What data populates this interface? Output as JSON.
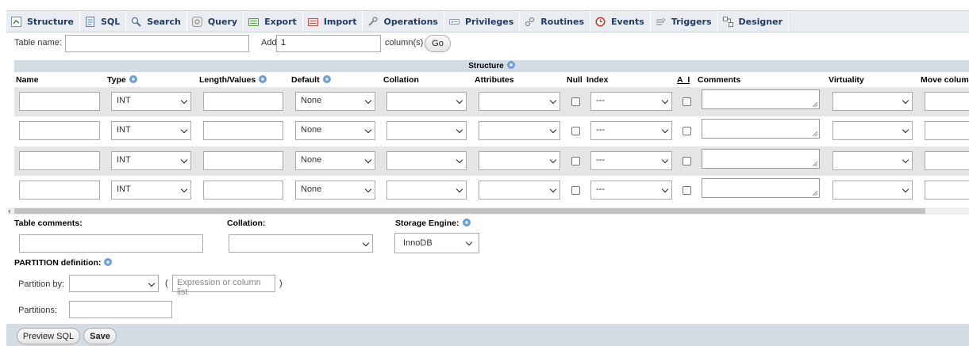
{
  "tabs": [
    {
      "label": "Structure",
      "icon": "structure-icon"
    },
    {
      "label": "SQL",
      "icon": "sql-icon"
    },
    {
      "label": "Search",
      "icon": "search-icon"
    },
    {
      "label": "Query",
      "icon": "query-icon"
    },
    {
      "label": "Export",
      "icon": "export-icon"
    },
    {
      "label": "Import",
      "icon": "import-icon"
    },
    {
      "label": "Operations",
      "icon": "wrench-icon"
    },
    {
      "label": "Privileges",
      "icon": "privileges-icon"
    },
    {
      "label": "Routines",
      "icon": "routines-icon"
    },
    {
      "label": "Events",
      "icon": "clock-icon"
    },
    {
      "label": "Triggers",
      "icon": "triggers-icon"
    },
    {
      "label": "Designer",
      "icon": "designer-icon"
    }
  ],
  "table_name": {
    "label": "Table name:",
    "value": ""
  },
  "add_columns": {
    "label": "Add",
    "value": "1",
    "suffix": "column(s)",
    "go": "Go"
  },
  "structure": {
    "title": "Structure",
    "columns": {
      "name": "Name",
      "type": "Type",
      "length": "Length/Values",
      "default": "Default",
      "collation": "Collation",
      "attributes": "Attributes",
      "null": "Null",
      "index": "Index",
      "ai": "A_I",
      "comments": "Comments",
      "virtuality": "Virtuality",
      "move": "Move column"
    },
    "rows": [
      {
        "type": "INT",
        "default": "None",
        "index": "---"
      },
      {
        "type": "INT",
        "default": "None",
        "index": "---"
      },
      {
        "type": "INT",
        "default": "None",
        "index": "---"
      },
      {
        "type": "INT",
        "default": "None",
        "index": "---"
      }
    ]
  },
  "table_options": {
    "comments_label": "Table comments:",
    "collation_label": "Collation:",
    "engine_label": "Storage Engine:",
    "engine_value": "InnoDB"
  },
  "partition": {
    "title": "PARTITION definition:",
    "by_label": "Partition by:",
    "open_paren": "(",
    "expression_placeholder": "Expression or column list",
    "close_paren": ")",
    "partitions_label": "Partitions:"
  },
  "actions": {
    "preview": "Preview SQL",
    "save": "Save"
  }
}
